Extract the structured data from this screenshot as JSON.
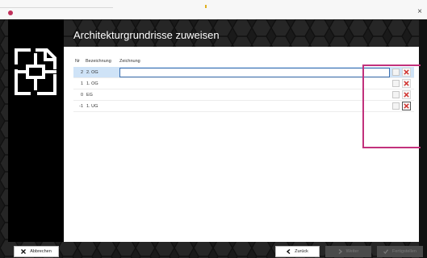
{
  "window": {
    "close_glyph": "×"
  },
  "header": {
    "title": "Architekturgrundrisse zuweisen"
  },
  "table": {
    "columns": {
      "nr": "Nr",
      "bezeichnung": "Bezeichnung",
      "zeichnung": "Zeichnung"
    },
    "rows": [
      {
        "nr": "2",
        "bezeichnung": "2. OG",
        "zeichnung": "",
        "selected": true
      },
      {
        "nr": "1",
        "bezeichnung": "1. OG",
        "zeichnung": "",
        "selected": false
      },
      {
        "nr": "0",
        "bezeichnung": "EG",
        "zeichnung": "",
        "selected": false
      },
      {
        "nr": "-1",
        "bezeichnung": "1. UG",
        "zeichnung": "",
        "selected": false
      }
    ]
  },
  "footer": {
    "cancel_label": "Abbrechen",
    "back_label": "Zurück",
    "next_label": "Weiter",
    "finish_label": "Fertigstellen"
  },
  "colors": {
    "accent_magenta": "#c2317c",
    "delete_red": "#d0312d",
    "selection_blue": "#cfe3f7",
    "window_dark": "#1a1a1a"
  },
  "icons": {
    "app": "app-icon",
    "logo": "floorplan-logo-icon",
    "more": "ellipsis-icon",
    "delete": "delete-x-icon",
    "cancel": "close-icon",
    "back": "chevron-left-icon",
    "next": "chevron-right-icon",
    "finish": "check-icon"
  }
}
